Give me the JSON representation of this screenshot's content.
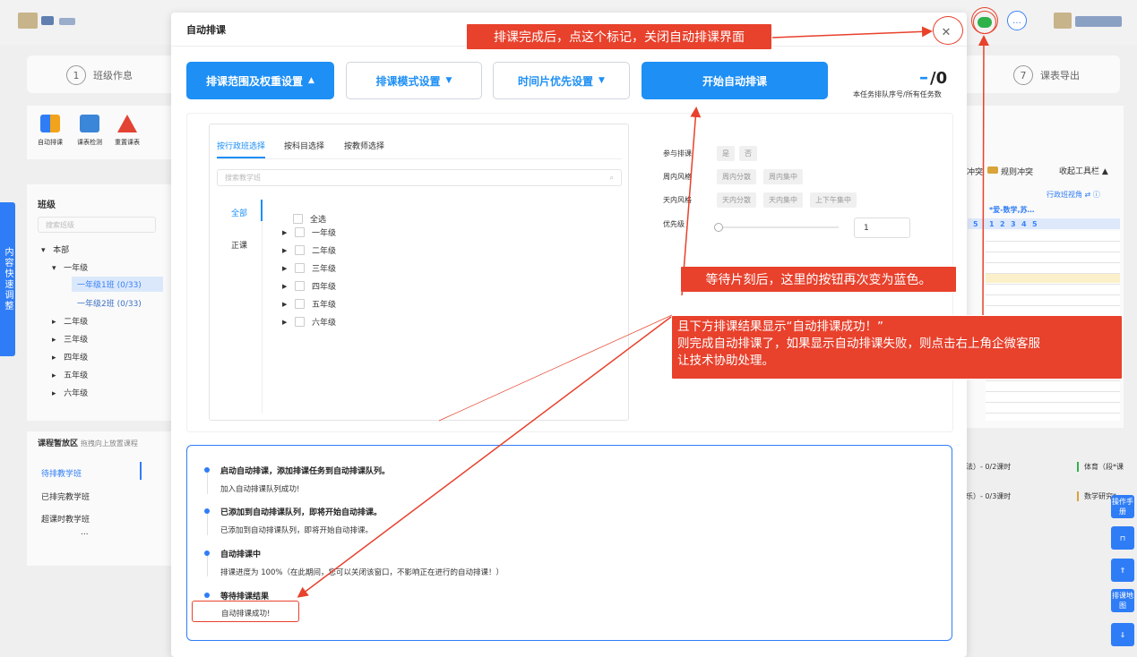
{
  "modal": {
    "title": "自动排课",
    "buttons": {
      "range": "排课范围及权重设置",
      "mode": "排课模式设置",
      "timeslot": "时间片优先设置",
      "start": "开始自动排课"
    },
    "queue": {
      "current": "–",
      "total": "/0",
      "caption": "本任务排队序号/所有任务数"
    },
    "selector": {
      "tabs": [
        "按行政班选择",
        "按科目选择",
        "按教师选择"
      ],
      "search_placeholder": "搜索教学班",
      "categories": [
        "全部",
        "正课"
      ],
      "select_all": "全选",
      "grades": [
        "一年级",
        "二年级",
        "三年级",
        "四年级",
        "五年级",
        "六年级"
      ]
    },
    "options": {
      "participate": {
        "label": "参与排课",
        "choices": [
          "是",
          "否"
        ]
      },
      "week_style": {
        "label": "周内风格",
        "choices": [
          "周内分散",
          "周内集中"
        ]
      },
      "day_style": {
        "label": "天内风格",
        "choices": [
          "天内分散",
          "天内集中",
          "上下午集中"
        ]
      },
      "priority": {
        "label": "优先级",
        "value": "1",
        "slider_fraction": 0
      }
    },
    "log": [
      {
        "head": "启动自动排课，添加排课任务到自动排课队列。",
        "sub": "加入自动排课队列成功!"
      },
      {
        "head": "已添加到自动排课队列，即将开始自动排课。",
        "sub": "已添加到自动排课队列，即将开始自动排课。"
      },
      {
        "head": "自动排课中",
        "sub": "排课进度为 100%（在此期间，您可以关闭该窗口，不影响正在进行的自动排课！）"
      },
      {
        "head": "等待排课结果",
        "sub": "自动排课成功!"
      }
    ]
  },
  "annotations": {
    "close_note": "排课完成后，点这个标记，关闭自动排课界面",
    "button_note": "等待片刻后，这里的按钮再次变为蓝色。",
    "result_note": [
      "且下方排课结果显示“自动排课成功！”",
      "则完成自动排课了，如果显示自动排课失败，则点击右上角企微客服",
      "让技术协助处理。"
    ]
  },
  "background": {
    "steps": [
      {
        "num": "1",
        "label": "班级作息"
      },
      {
        "num": "7",
        "label": "课表导出"
      }
    ],
    "tools": [
      "自动排课",
      "课表检测",
      "重置课表"
    ],
    "left_title": "班级",
    "left_search": "搜索班级",
    "tree": [
      "本部",
      "一年级",
      "一年级1班 (0/33)",
      "一年级2班 (0/33)",
      "二年级",
      "三年级",
      "四年级",
      "五年级",
      "六年级"
    ],
    "side_tab": "内容快速调整",
    "bottom_title": "课程暂放区",
    "bottom_hint": "拖拽向上放置课程",
    "bottom_items": [
      "待排教学班",
      "已排完教学班",
      "超课时教学班",
      "..."
    ],
    "bottom_right_items": [
      "法）- 0/2课时",
      "体育（段*课",
      "乐）- 0/3课时",
      "数学研究*"
    ],
    "legend": [
      "冲突",
      "规则冲突"
    ],
    "collapse_tools": "收起工具栏",
    "view_label": "行政班视角",
    "grid_header": "*爱-数学,苏…",
    "grid_cols": [
      "5",
      "1",
      "2",
      "3",
      "4",
      "5"
    ],
    "right_buttons": [
      "操作手册",
      "排课地图"
    ],
    "colors": {
      "accent": "#1d8ff5",
      "annotation": "#e8412c",
      "wechat": "#2eb14a"
    }
  }
}
